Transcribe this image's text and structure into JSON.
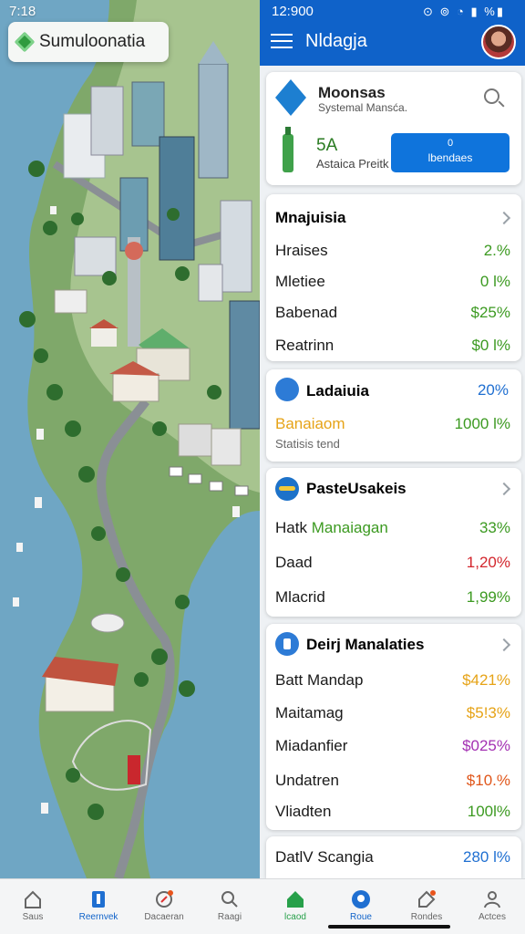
{
  "map": {
    "status_time": "7:18",
    "chip_label": "Sumuloonatia"
  },
  "appbar": {
    "time": "12:900",
    "title": "Nldagja"
  },
  "summary_card": {
    "title": "Moonsas",
    "subtitle": "Systemal Mansća.",
    "big_value": "5A",
    "big_label": "Astaica Preitk",
    "button_number": "0",
    "button_label": "lbendaes"
  },
  "card_markets": {
    "title": "Mnajuisia",
    "rows": [
      {
        "label": "Hraises",
        "value": "2.%"
      },
      {
        "label": "Mletiee",
        "value": "0 l%"
      },
      {
        "label": "Babenad",
        "value": "$25%"
      },
      {
        "label": "Reatrinn",
        "value": "$0 l%"
      }
    ]
  },
  "card_ladaiuia": {
    "title": "Ladaiuia",
    "value": "20%",
    "label2": "Banaiaom",
    "value2": "1000 l%",
    "footnote": "Statisis tend"
  },
  "card_paste": {
    "title": "PasteUsakeis",
    "rows": [
      {
        "label_a": "Hatk",
        "label_b": "Manaiagan",
        "value": "33%"
      },
      {
        "label_a": "Daad",
        "label_b": "",
        "value": "1,20%"
      },
      {
        "label_a": "Mlacrid",
        "label_b": "",
        "value": "1,99%"
      }
    ]
  },
  "card_deiry": {
    "title": "Deirj Manalaties",
    "rows": [
      {
        "label": "Batt Mandap",
        "value": "$421%"
      },
      {
        "label": "Maitamag",
        "value": "$5!3%"
      },
      {
        "label": "Miadanfier",
        "value": "$025%"
      },
      {
        "label": "Undatren",
        "value": "$10.%"
      },
      {
        "label": "Vliadten",
        "value": "100l%"
      }
    ]
  },
  "card_bottom": {
    "label": "DatlV Scangia",
    "value": "280 l%"
  },
  "bottom_nav": [
    {
      "label": "Saus",
      "icon": "home-outline-icon"
    },
    {
      "label": "Reernvek",
      "icon": "pen-icon"
    },
    {
      "label": "Dacaeran",
      "icon": "compass-icon"
    },
    {
      "label": "Raagi",
      "icon": "search-icon"
    },
    {
      "label": "lcaod",
      "icon": "home-icon"
    },
    {
      "label": "Roue",
      "icon": "location-icon"
    },
    {
      "label": "Rondes",
      "icon": "tag-icon"
    },
    {
      "label": "Actces",
      "icon": "person-icon"
    }
  ]
}
